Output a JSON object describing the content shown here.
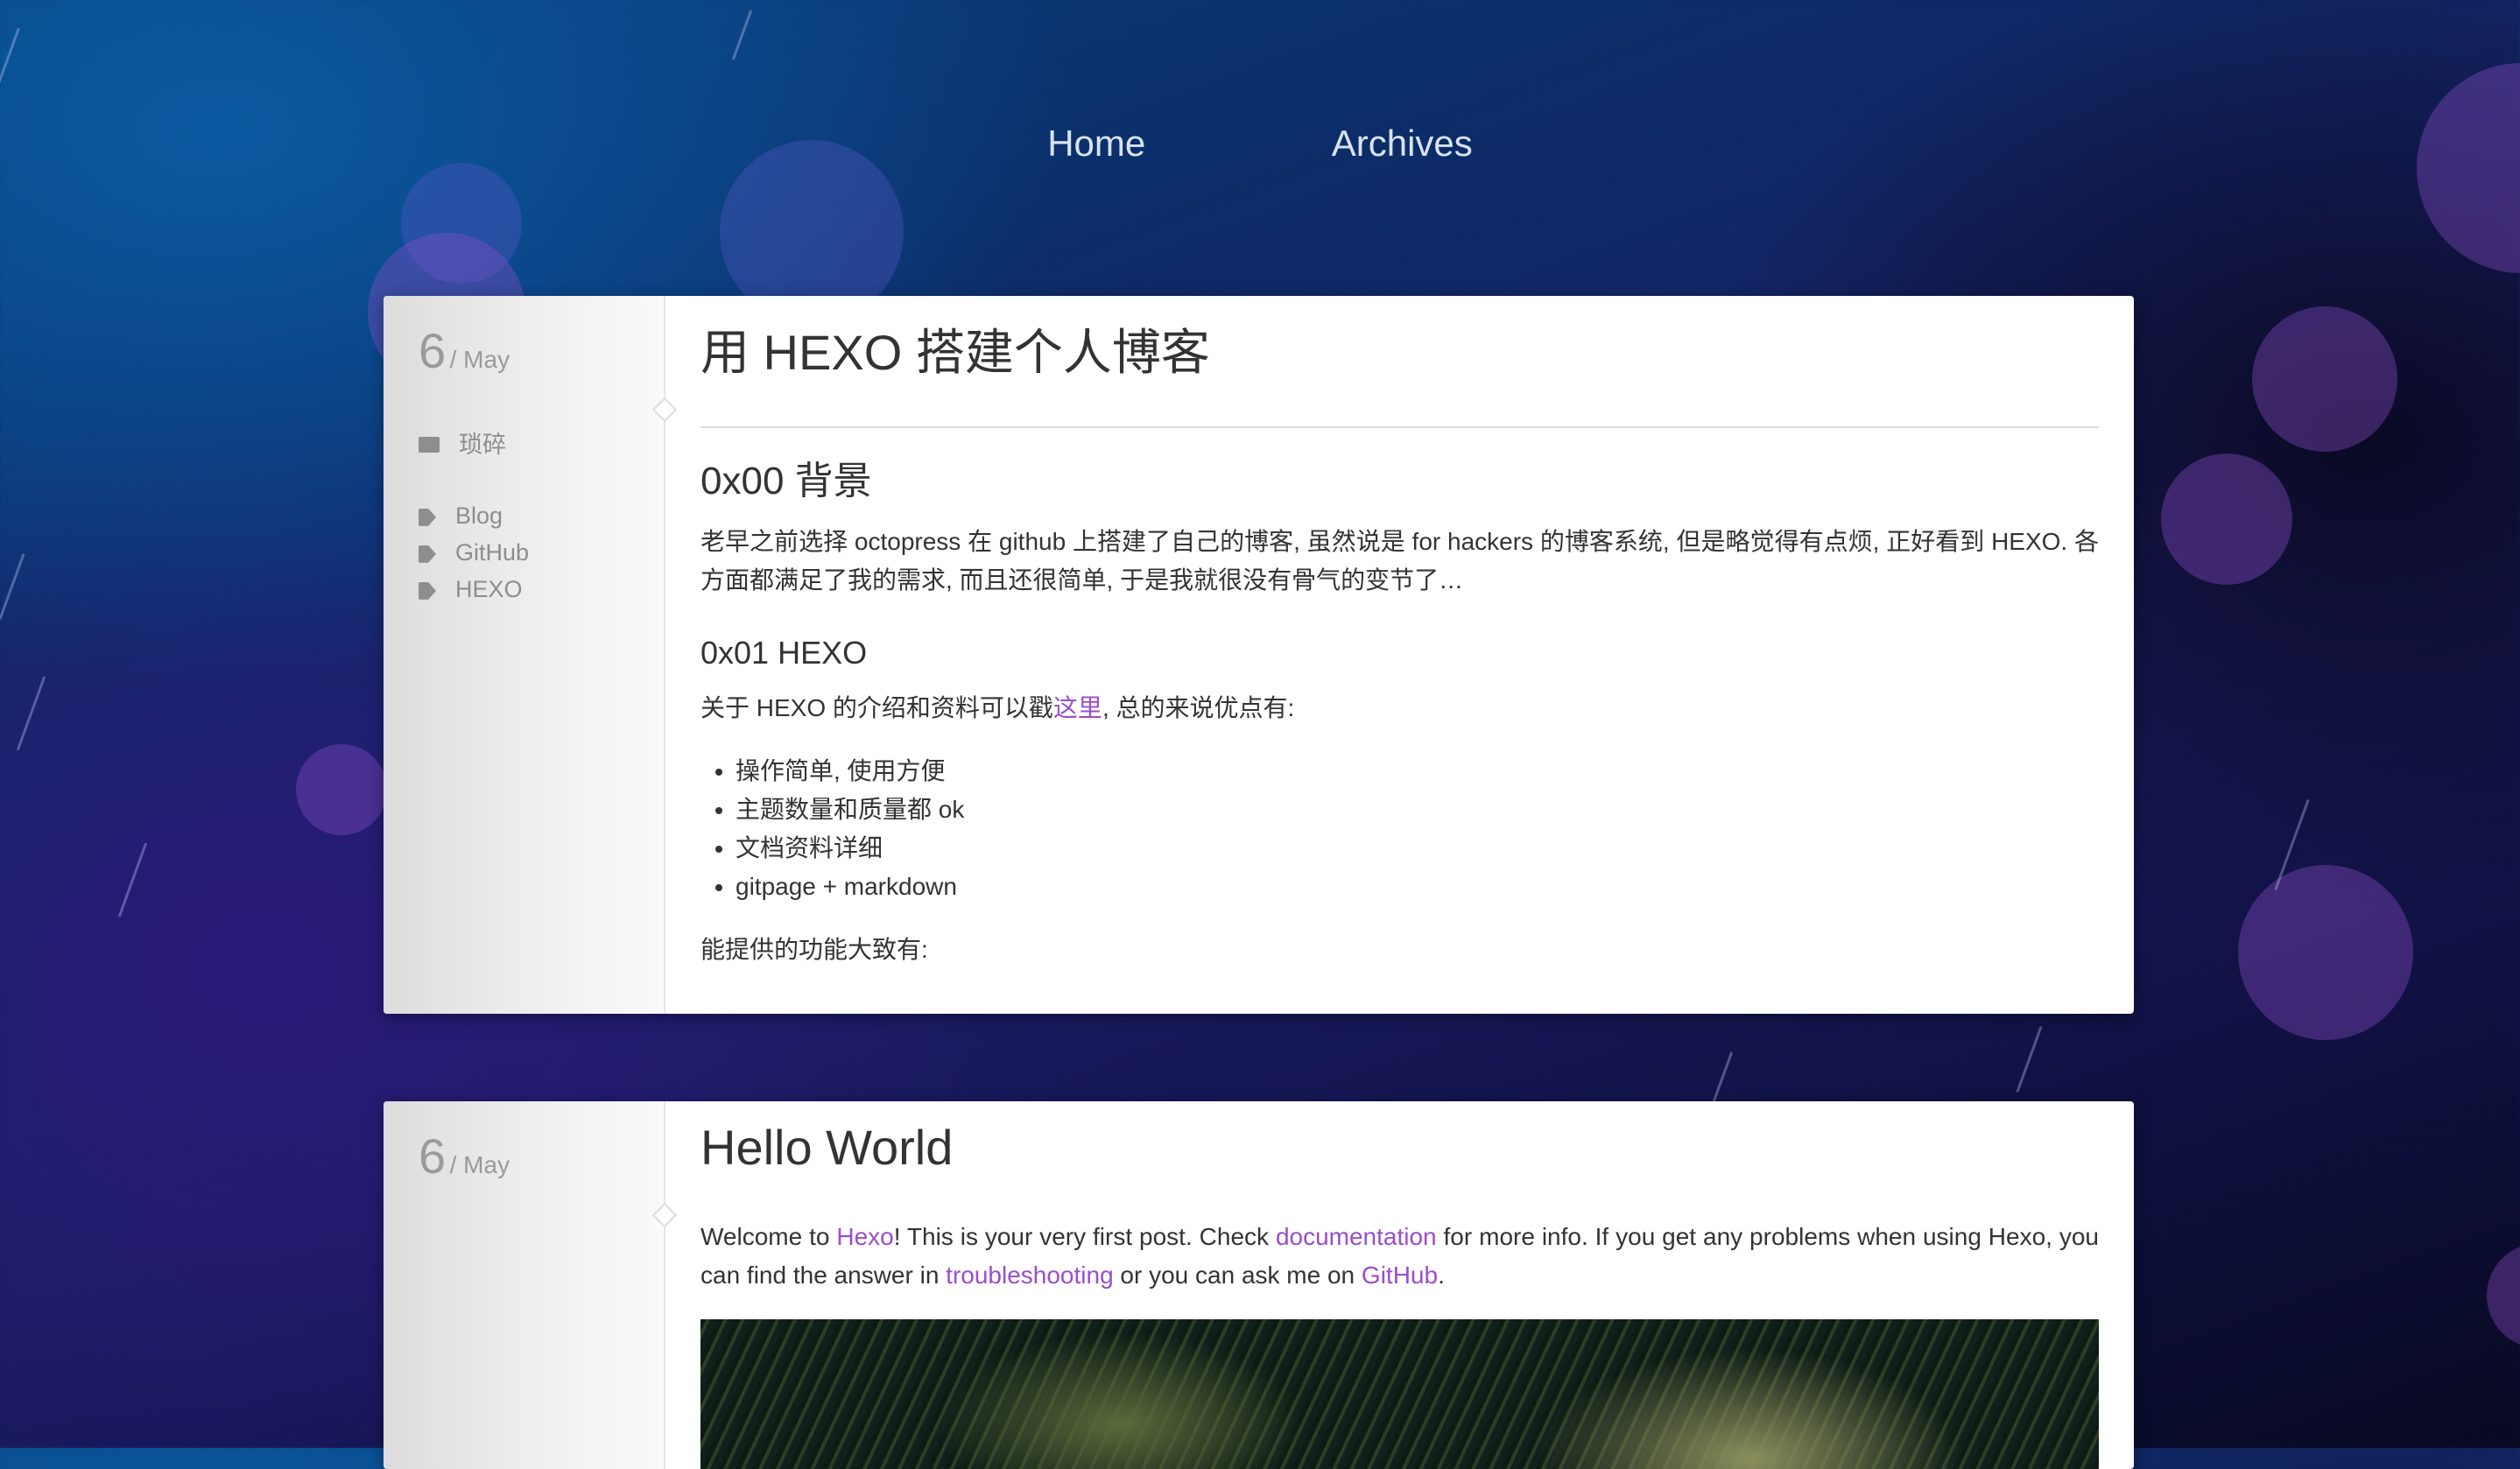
{
  "nav": {
    "home": "Home",
    "archives": "Archives"
  },
  "posts": [
    {
      "day": "6",
      "month": "/ May",
      "category": "琐碎",
      "tags": [
        "Blog",
        "GitHub",
        "HEXO"
      ],
      "title": "用 HEXO 搭建个人博客",
      "section1_heading": "0x00 背景",
      "section1_text": "老早之前选择 octopress 在 github 上搭建了自己的博客, 虽然说是 for hackers 的博客系统, 但是略觉得有点烦, 正好看到 HEXO. 各方面都满足了我的需求, 而且还很简单, 于是我就很没有骨气的变节了…",
      "section2_heading": "0x01 HEXO",
      "section2_text_before": "关于 HEXO 的介绍和资料可以戳",
      "section2_link": "这里",
      "section2_text_after": ", 总的来说优点有:",
      "bullets": [
        "操作简单, 使用方便",
        "主题数量和质量都 ok",
        "文档资料详细",
        "gitpage + markdown"
      ],
      "features_text": "能提供的功能大致有:"
    },
    {
      "day": "6",
      "month": "/ May",
      "title": "Hello World",
      "p_welcome": "Welcome to ",
      "link_hexo": "Hexo",
      "p_first": "! This is your very first post. Check ",
      "link_docs": "documentation",
      "p_more": " for more info. If you get any problems when using Hexo, you can find the answer in ",
      "link_trouble": "troubleshooting",
      "p_ask": " or you can ask me on ",
      "link_github": "GitHub",
      "p_end": "."
    }
  ],
  "colors": {
    "link": "#9b4dca",
    "nav_text": "#d8e3f2",
    "body_text": "#333333"
  }
}
